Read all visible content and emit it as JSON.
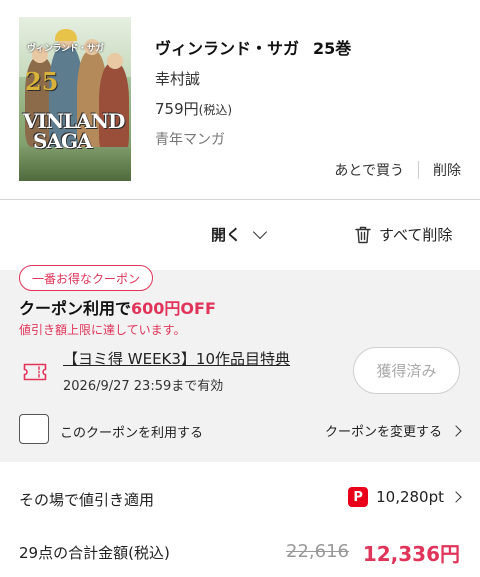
{
  "product": {
    "cover_title_top": "ヴィンランド・サガ",
    "cover_volume": "25",
    "cover_logo_line1": "VINLAND",
    "cover_logo_line2": "SAGA",
    "title": "ヴィンランド・サガ",
    "volume": "25巻",
    "author": "幸村誠",
    "price": "759円",
    "price_tax": "(税込)",
    "genre": "青年マンガ",
    "later_label": "あとで買う",
    "delete_label": "削除"
  },
  "expand": {
    "open_label": "開く",
    "delete_all_label": "すべて削除"
  },
  "coupon": {
    "badge": "一番お得なクーポン",
    "head_prefix": "クーポン利用で",
    "head_amount": "600円OFF",
    "note": "値引き額上限に達しています。",
    "name": "【ヨミ得 WEEK3】10作品目特典",
    "expiry": "2026/9/27 23:59まで有効",
    "acquired_label": "獲得済み",
    "use_label": "このクーポンを利用する",
    "change_label": "クーポンを変更する",
    "accent_color": "#e0345a"
  },
  "points": {
    "label": "その場で値引き適用",
    "icon_text": "P",
    "value": "10,280pt"
  },
  "total": {
    "label": "29点の合計金額(税込)",
    "original": "22,616",
    "final": "12,336円"
  }
}
